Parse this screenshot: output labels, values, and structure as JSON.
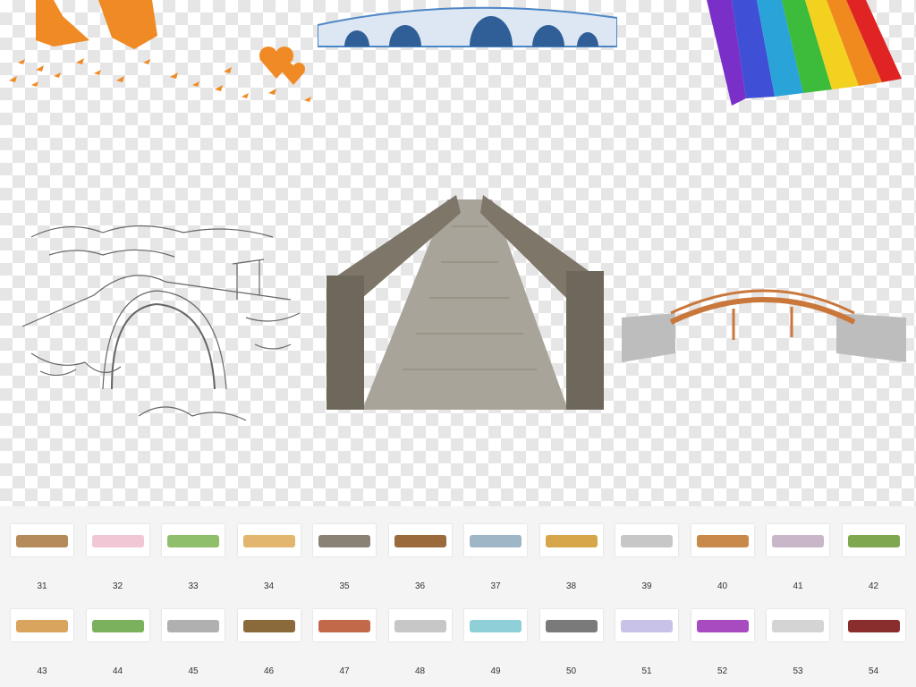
{
  "thumbnails": {
    "row1": [
      "31",
      "32",
      "33",
      "34",
      "35",
      "36",
      "37",
      "38",
      "39",
      "40",
      "41",
      "42"
    ],
    "row2": [
      "43",
      "44",
      "45",
      "46",
      "47",
      "48",
      "49",
      "50",
      "51",
      "52",
      "53",
      "54"
    ]
  },
  "colors": {
    "silhouette": "#f08a24",
    "stone_blue": "#4d86c6",
    "plank": "#8b8576",
    "railing_red": "#c9773a"
  }
}
